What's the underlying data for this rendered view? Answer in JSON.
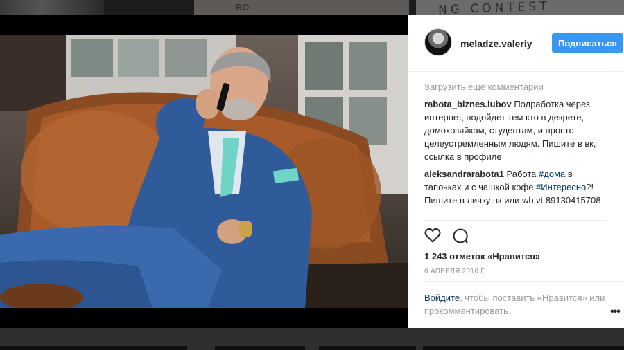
{
  "background": {
    "tile_text": "NG CONTEST",
    "tile_text_left": "RO"
  },
  "post": {
    "username": "meladze.valeriy",
    "follow_label": "Подписаться",
    "load_more": "Загрузить еще комментарии",
    "comments": [
      {
        "user": "rabota_biznes.lubov",
        "parts": [
          {
            "text": " Подработка через интернет, подойдет тем кто в декрете, домохозяйкам, студентам, и просто целеустремленным людям. Пишите в вк, ссылка в профиле",
            "hashtag": false
          }
        ]
      },
      {
        "user": "aleksandrarabota1",
        "parts": [
          {
            "text": " Работа ",
            "hashtag": false
          },
          {
            "text": "#дома",
            "hashtag": true
          },
          {
            "text": " в тапочках и с чашкой кофе.",
            "hashtag": false
          },
          {
            "text": "#Интересно",
            "hashtag": true
          },
          {
            "text": "?! Пишите в личку вк.или wb,vt 89130415708",
            "hashtag": false
          }
        ]
      }
    ],
    "likes": "1 243 отметок «Нравится»",
    "date": "6 АПРЕЛЯ 2016 Г.",
    "login_link": "Войдите",
    "login_rest": ", чтобы поставить «Нравится» или прокомментировать.",
    "more_icon": "ellipsis-icon"
  },
  "icons": {
    "heart": "heart-icon",
    "comment": "comment-icon"
  },
  "colors": {
    "accent": "#3897f0",
    "link": "#003569",
    "muted": "#999999"
  }
}
